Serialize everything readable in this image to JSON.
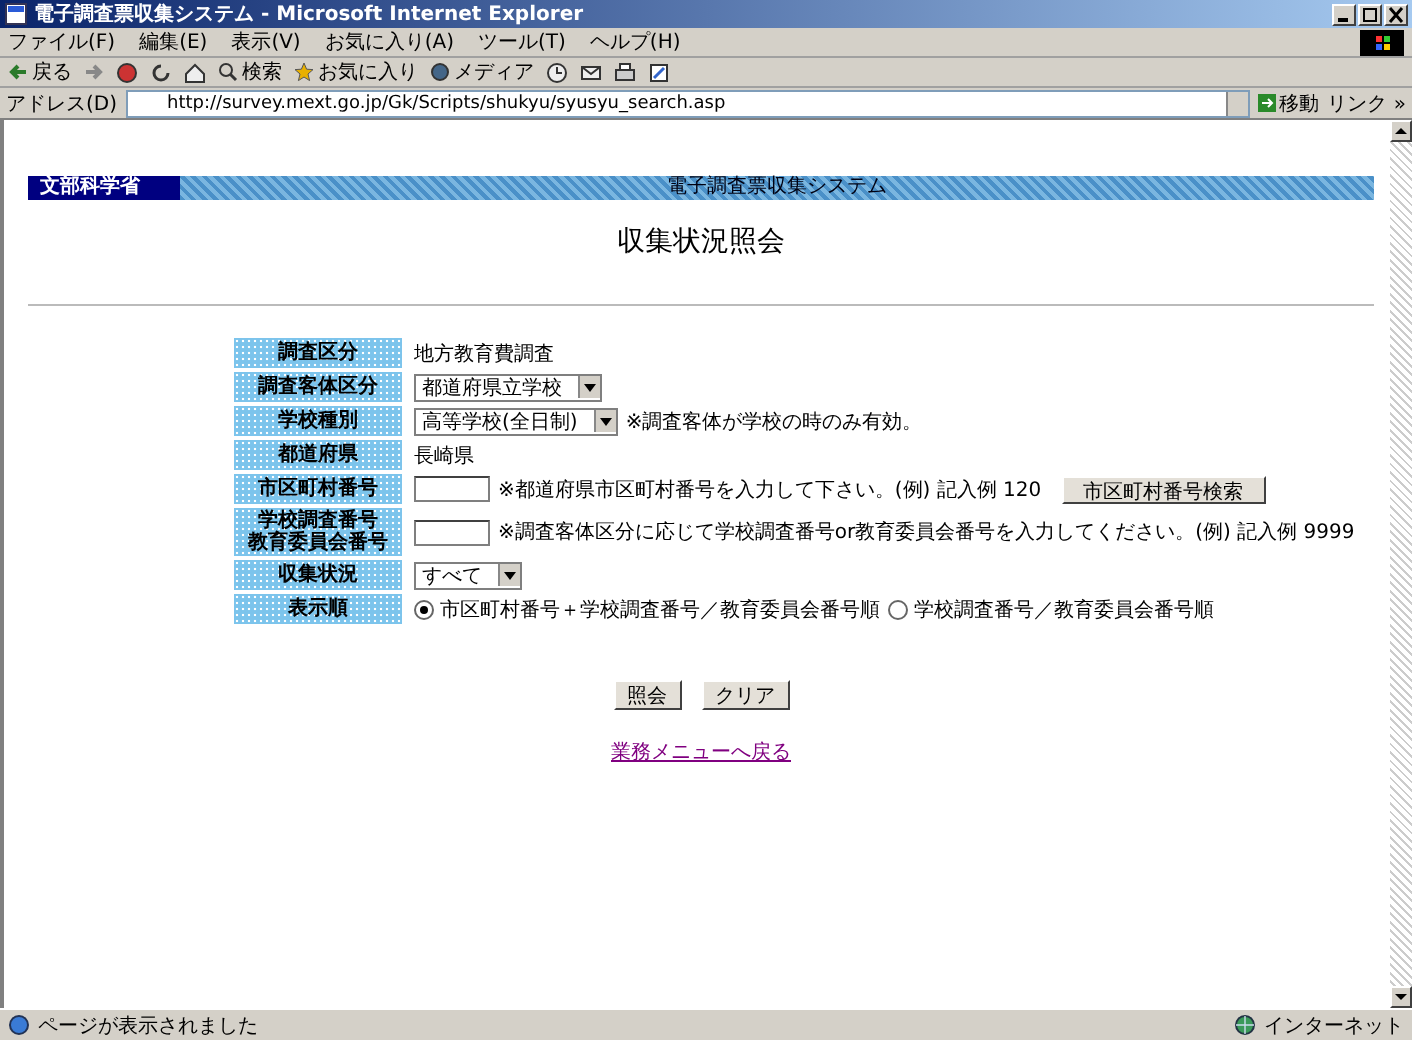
{
  "window": {
    "title": "電子調査票収集システム - Microsoft Internet Explorer"
  },
  "menu": [
    "ファイル(F)",
    "編集(E)",
    "表示(V)",
    "お気に入り(A)",
    "ツール(T)",
    "ヘルプ(H)"
  ],
  "toolbar": {
    "back": "戻る",
    "search": "検索",
    "favorites": "お気に入り",
    "media": "メディア"
  },
  "address_bar": {
    "label": "アドレス(D)",
    "url": "http://survey.mext.go.jp/Gk/Scripts/shukyu/syusyu_search.asp",
    "go": "移動",
    "links": "リンク »"
  },
  "page": {
    "ministry": "文部科学省",
    "system": "電子調査票収集システム",
    "title": "収集状況照会",
    "rows": [
      {
        "label": "調査区分",
        "kind": "text",
        "value": "地方教育費調査"
      },
      {
        "label": "調査客体区分",
        "kind": "select",
        "value": "都道府県立学校"
      },
      {
        "label": "学校種別",
        "kind": "select",
        "value": "高等学校(全日制)",
        "note": "※調査客体が学校の時のみ有効。"
      },
      {
        "label": "都道府県",
        "kind": "text",
        "value": "長崎県"
      },
      {
        "label": "市区町村番号",
        "kind": "input",
        "note": "※都道府県市区町村番号を入力して下さい。(例) 記入例 120",
        "button": "市区町村番号検索"
      },
      {
        "label": [
          "学校調査番号",
          "教育委員会番号"
        ],
        "kind": "input",
        "note": "※調査客体区分に応じて学校調査番号or教育委員会番号を入力してください。(例) 記入例 9999"
      },
      {
        "label": "収集状況",
        "kind": "select",
        "value": "すべて"
      },
      {
        "label": "表示順",
        "kind": "radio",
        "options": [
          {
            "label": "市区町村番号＋学校調査番号／教育委員会番号順",
            "selected": true
          },
          {
            "label": "学校調査番号／教育委員会番号順",
            "selected": false
          }
        ]
      }
    ],
    "buttons": [
      "照会",
      "クリア"
    ],
    "link": "業務メニューへ戻る"
  },
  "status_bar": {
    "message": "ページが表示されました",
    "zone": "インターネット"
  }
}
